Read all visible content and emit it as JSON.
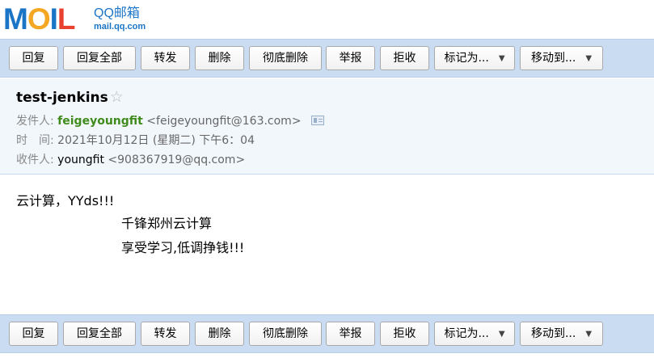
{
  "logo": {
    "brand": "MOIL",
    "name": "QQ邮箱",
    "domain": "mail.qq.com"
  },
  "toolbar": {
    "reply": "回复",
    "reply_all": "回复全部",
    "forward": "转发",
    "delete": "删除",
    "delete_permanently": "彻底删除",
    "report": "举报",
    "reject": "拒收",
    "mark_as": "标记为...",
    "move_to": "移动到..."
  },
  "mail": {
    "subject": "test-jenkins",
    "from_label": "发件人:",
    "from_name": "feigeyoungfit",
    "from_address": "<feigeyoungfit@163.com>",
    "time_label": "时　间:",
    "time_value": "2021年10月12日 (星期二) 下午6：04",
    "to_label": "收件人:",
    "to_name": "youngfit",
    "to_address": "<908367919@qq.com>",
    "body_lines": [
      "云计算，YYds!!!",
      "千锋郑州云计算",
      "享受学习,低调挣钱!!!"
    ]
  },
  "colors": {
    "toolbar_bg": "#c9dcf2",
    "header_bg": "#f2f7fc",
    "sender_name": "#3f8b1c",
    "logo_blue": "#1b75c7"
  }
}
